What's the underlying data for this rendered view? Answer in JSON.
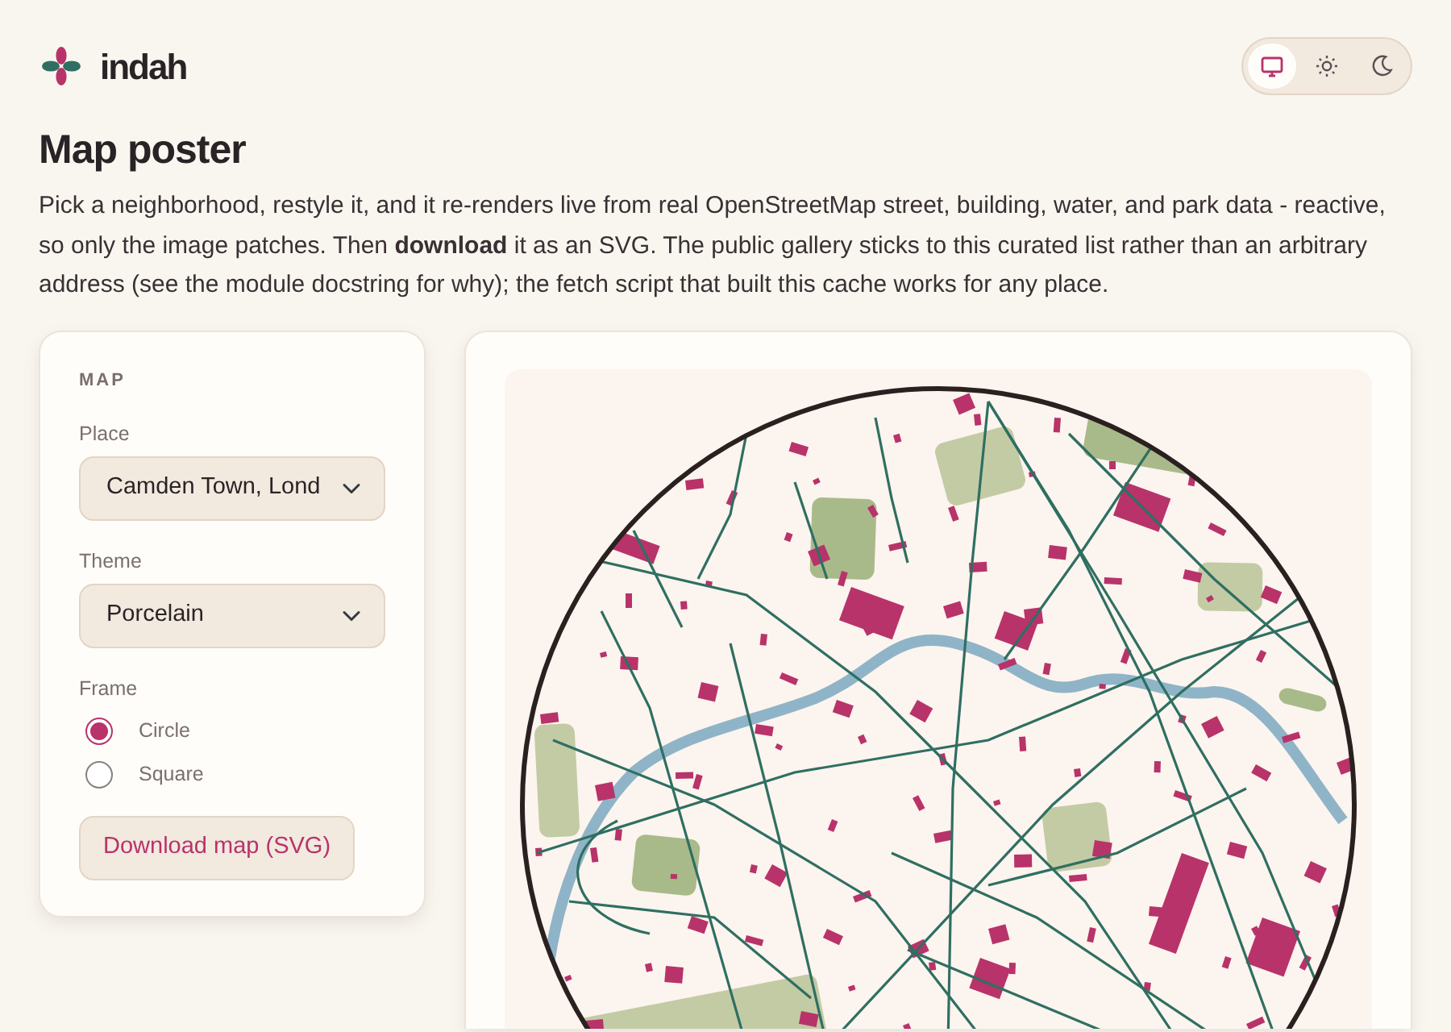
{
  "brand": {
    "name": "indah"
  },
  "theme_switcher": [
    {
      "kind": "system",
      "selected": true
    },
    {
      "kind": "light",
      "selected": false
    },
    {
      "kind": "dark",
      "selected": false
    }
  ],
  "page": {
    "title": "Map poster",
    "intro": "Pick a neighborhood, restyle it, and it re-renders live from real OpenStreetMap street, building, water, and park data - reactive, so only the image patches. Then **download** it as an SVG. The public gallery sticks to this curated list rather than an arbitrary address (see the module docstring for why); the fetch script that built this cache works for any place."
  },
  "controls": {
    "heading": "MAP",
    "place": {
      "label": "Place",
      "value": "Camden Town, Lond"
    },
    "theme": {
      "label": "Theme",
      "value": "Porcelain"
    },
    "frame": {
      "label": "Frame",
      "options": [
        {
          "label": "Circle",
          "kind": "circle",
          "selected": true
        },
        {
          "label": "Square",
          "kind": "square",
          "selected": false
        }
      ]
    },
    "download_button": "Download map (SVG)"
  }
}
